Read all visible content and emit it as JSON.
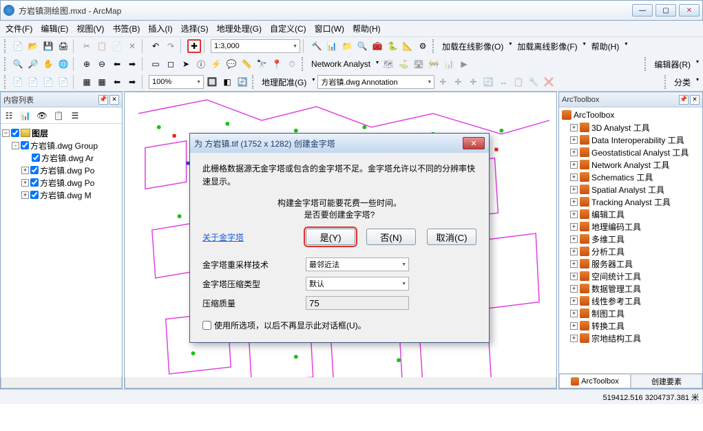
{
  "window": {
    "title": "方岩镇测绘图.mxd - ArcMap"
  },
  "menu": [
    "文件(F)",
    "编辑(E)",
    "视图(V)",
    "书签(B)",
    "插入(I)",
    "选择(S)",
    "地理处理(G)",
    "自定义(C)",
    "窗口(W)",
    "帮助(H)"
  ],
  "row1": {
    "scale": "1:3,000",
    "online_imagery": "加载在线影像(O)",
    "offline_imagery": "加载离线影像(F)",
    "help": "帮助(H)"
  },
  "row2": {
    "network_analyst": "Network Analyst",
    "editor": "编辑器(R)"
  },
  "row3": {
    "zoom_pct": "100%",
    "georef": "地理配准(G)",
    "layer_combo": "方岩镇.dwg Annotation",
    "classify": "分类"
  },
  "toc": {
    "title": "内容列表",
    "root": "图层",
    "items": [
      {
        "label": "方岩镇.dwg Group",
        "exp": "-"
      },
      {
        "label": "方岩镇.dwg Ar",
        "indent": true
      },
      {
        "label": "方岩镇.dwg Po",
        "exp": "+",
        "indent": true
      },
      {
        "label": "方岩镇.dwg Po",
        "exp": "+",
        "indent": true
      },
      {
        "label": "方岩镇.dwg M",
        "exp": "+",
        "indent": true
      }
    ]
  },
  "arctoolbox": {
    "title": "ArcToolbox",
    "root": "ArcToolbox",
    "items": [
      "3D Analyst 工具",
      "Data Interoperability 工具",
      "Geostatistical Analyst 工具",
      "Network Analyst 工具",
      "Schematics 工具",
      "Spatial Analyst 工具",
      "Tracking Analyst 工具",
      "编辑工具",
      "地理编码工具",
      "多维工具",
      "分析工具",
      "服务器工具",
      "空间统计工具",
      "数据管理工具",
      "线性参考工具",
      "制图工具",
      "转换工具",
      "宗地结构工具"
    ],
    "tabs": {
      "toolbox": "ArcToolbox",
      "create": "创建要素"
    }
  },
  "dialog": {
    "title": "为 方岩镇.tif (1752 x 1282) 创建金字塔",
    "msg1": "此栅格数据源无金字塔或包含的金字塔不足。金字塔允许以不同的分辨率快速显示。",
    "msg2a": "构建金字塔可能要花费一些时间。",
    "msg2b": "是否要创建金字塔?",
    "link": "关于金字塔",
    "yes": "是(Y)",
    "no": "否(N)",
    "cancel": "取消(C)",
    "resample_label": "金字塔重采样技术",
    "resample_value": "最邻近法",
    "compress_label": "金字塔压缩类型",
    "compress_value": "默认",
    "quality_label": "压缩质量",
    "quality_value": "75",
    "remember": "使用所选项，以后不再显示此对话框(U)。"
  },
  "status": {
    "coords": "519412.516 3204737.381 米"
  }
}
